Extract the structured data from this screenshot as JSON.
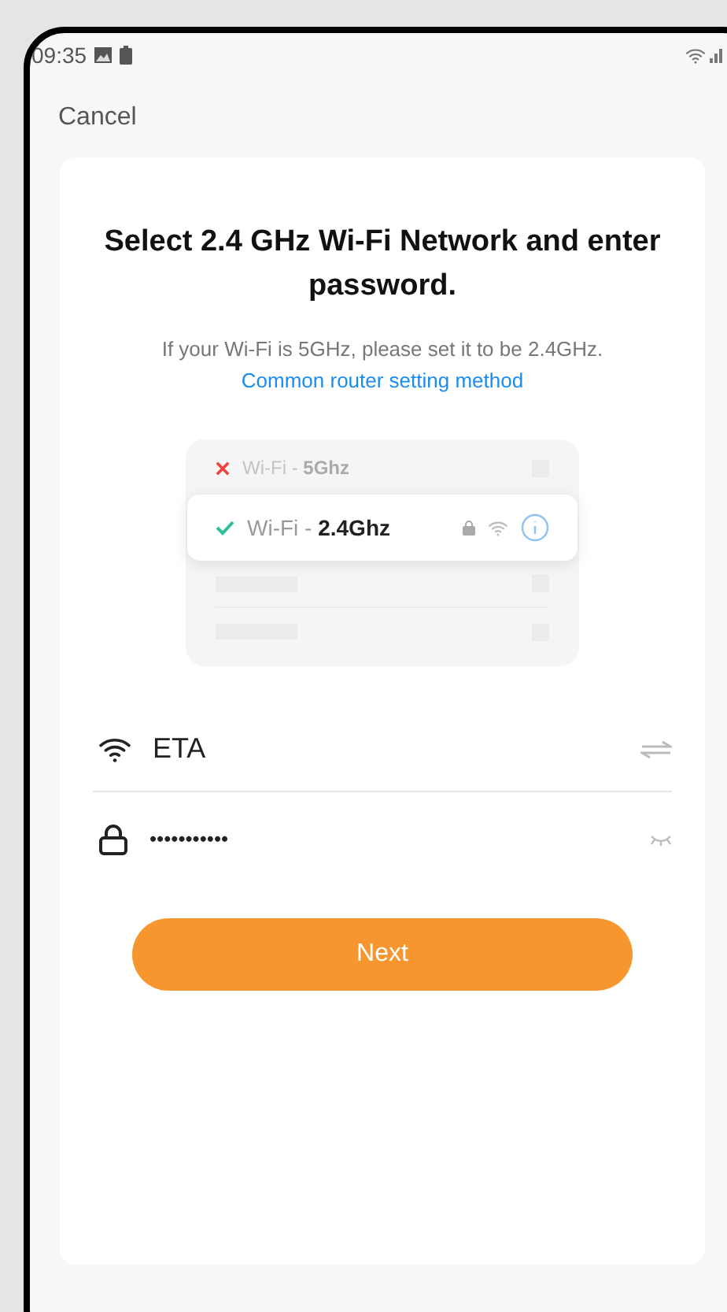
{
  "status_bar": {
    "time": "09:35"
  },
  "cancel": "Cancel",
  "title": "Select 2.4 GHz Wi-Fi Network and enter password.",
  "hint": "If your Wi-Fi is 5GHz, please set it to be 2.4GHz.",
  "help_link": "Common router setting method",
  "illustration": {
    "networks": [
      {
        "prefix": "Wi-Fi - ",
        "band": "5Ghz",
        "supported": false
      },
      {
        "prefix": "Wi-Fi - ",
        "band": "2.4Ghz",
        "supported": true
      }
    ]
  },
  "network_name": {
    "value": "ETA"
  },
  "password": {
    "value": "•••••••••••"
  },
  "next_button": "Next"
}
